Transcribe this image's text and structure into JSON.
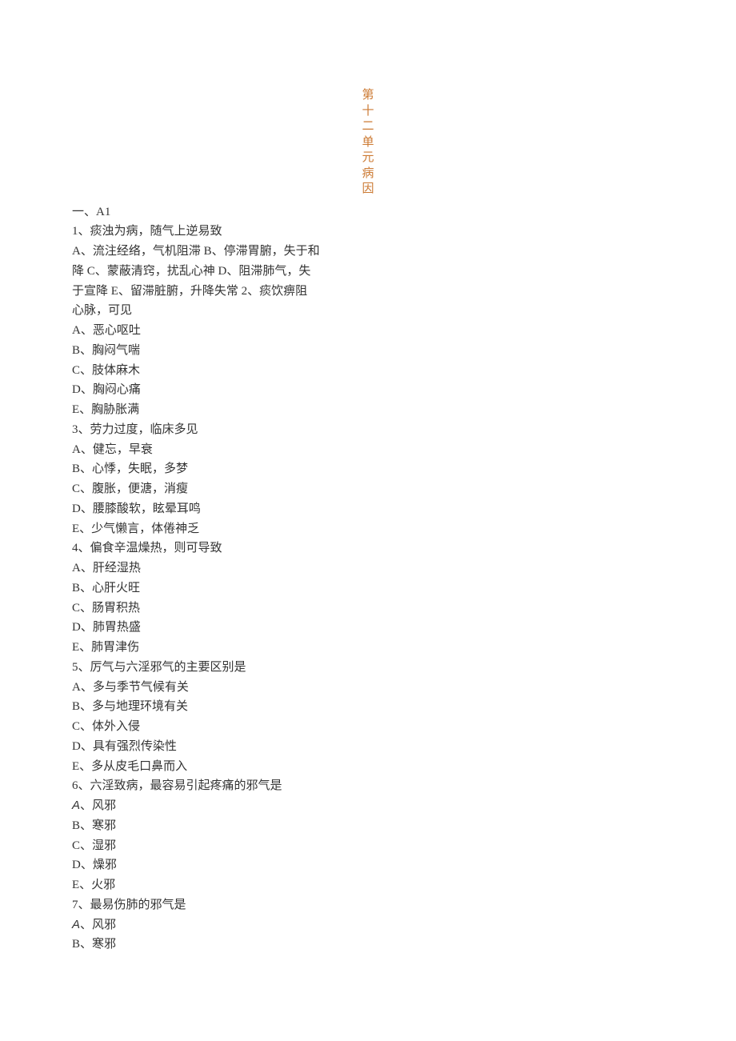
{
  "title_chars": [
    "第",
    "十",
    "二",
    "单",
    "元",
    "病",
    "因"
  ],
  "section_header": "一、A1",
  "q1": {
    "stem": "1、痰浊为病，随气上逆易致",
    "wrap1": "A、流注经络，气机阻滞 B、停滞胃腑，失于和",
    "wrap2": "降 C、蒙蔽清窍，扰乱心神 D、阻滞肺气，失",
    "wrap3": "于宣降 E、留滞脏腑，升降失常 2、痰饮痹阻",
    "wrap4": "心脉，可见"
  },
  "q2_opts": {
    "A": "A、恶心呕吐",
    "B": "B、胸闷气喘",
    "C": "C、肢体麻木",
    "D": "D、胸闷心痛",
    "E": "E、胸胁胀满"
  },
  "q3": {
    "stem": "3、劳力过度，临床多见",
    "A": "A、健忘，早衰",
    "B": "B、心悸，失眠，多梦",
    "C": "C、腹胀，便溏，消瘦",
    "D": "D、腰膝酸软，眩晕耳鸣",
    "E": "E、少气懒言，体倦神乏"
  },
  "q4": {
    "stem": "4、偏食辛温燥热，则可导致",
    "A": "A、肝经湿热",
    "B": "B、心肝火旺",
    "C": "C、肠胃积热",
    "D": "D、肺胃热盛",
    "E": "E、肺胃津伤"
  },
  "q5": {
    "stem": "5、厉气与六淫邪气的主要区别是",
    "A": "A、多与季节气候有关",
    "B": "B、多与地理环境有关",
    "C": "C、体外入侵",
    "D": "D、具有强烈传染性",
    "E": "E、多从皮毛口鼻而入"
  },
  "q6": {
    "stem": "6、六淫致病，最容易引起疼痛的邪气是",
    "A_label": "A",
    "A_text": "、风邪",
    "B": "B、寒邪",
    "C": "C、湿邪",
    "D": "D、燥邪",
    "E": "E、火邪"
  },
  "q7": {
    "stem": "7、最易伤肺的邪气是",
    "A_label": "A",
    "A_text": "、风邪",
    "B": "B、寒邪"
  }
}
